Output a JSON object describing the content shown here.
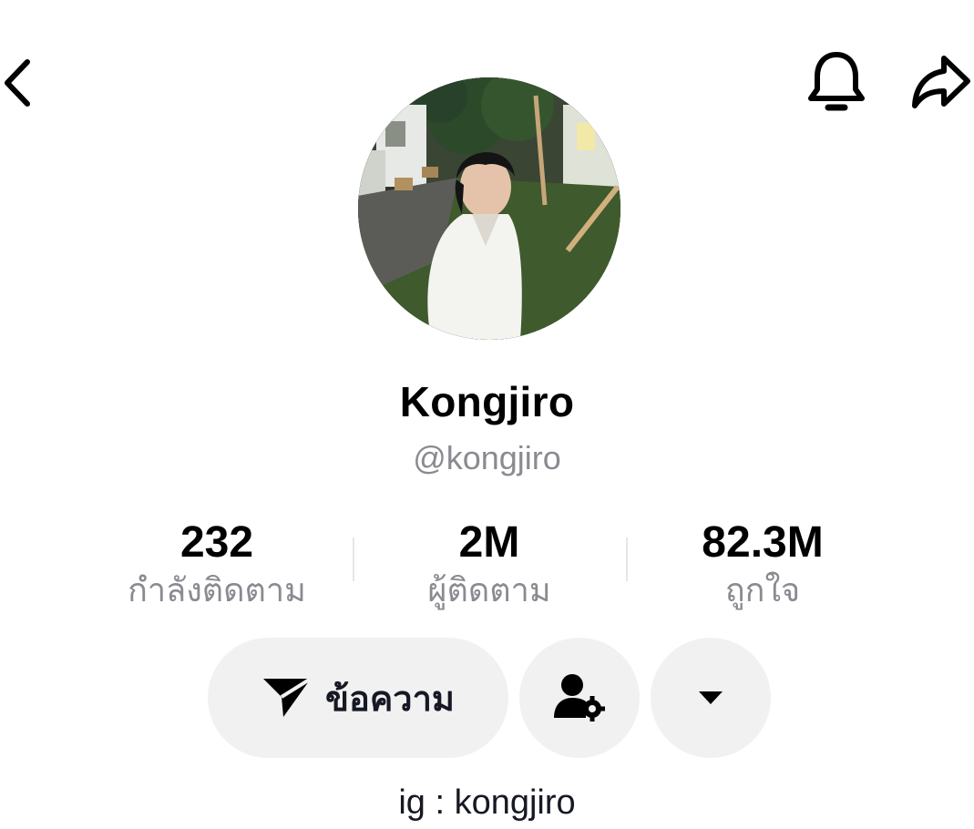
{
  "header": {
    "back_icon": "chevron-left-icon",
    "bell_icon": "bell-icon",
    "share_icon": "share-arrow-icon"
  },
  "profile": {
    "display_name": "Kongjiro",
    "handle": "@kongjiro",
    "bio": "ig : kongjiro"
  },
  "stats": [
    {
      "value": "232",
      "label": "กำลังติดตาม"
    },
    {
      "value": "2M",
      "label": "ผู้ติดตาม"
    },
    {
      "value": "82.3M",
      "label": "ถูกใจ"
    }
  ],
  "actions": {
    "message_label": "ข้อความ",
    "message_icon": "send-icon",
    "settings_icon": "user-settings-icon",
    "more_icon": "caret-down-icon"
  },
  "colors": {
    "text_primary": "#000000",
    "text_secondary": "#8a8b91",
    "button_bg": "#f1f1f2"
  }
}
